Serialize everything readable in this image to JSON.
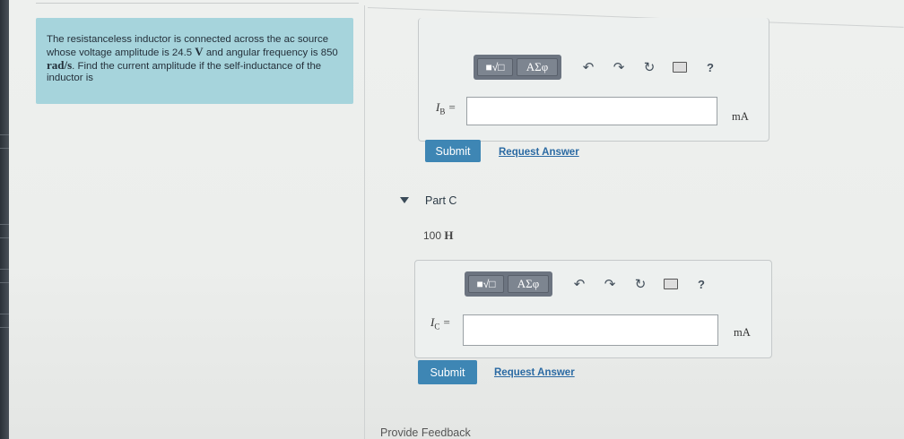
{
  "problem": {
    "text_1": "The resistanceless inductor is connected across the ac source whose voltage amplitude is 24.5 ",
    "voltage_unit": "V",
    "text_2": " and angular frequency is 850 ",
    "freq_unit": "rad/s",
    "text_3": ". Find the current amplitude if the self-inductance of the inductor is"
  },
  "part_b": {
    "var_main": "I",
    "var_sub": "B",
    "equals": " =",
    "input_value": "",
    "unit": "mA",
    "submit_label": "Submit",
    "request_label": "Request Answer"
  },
  "toolbar": {
    "matrix_label": "■√□",
    "greek_label": "ΑΣφ",
    "icons": [
      "undo-icon",
      "redo-icon",
      "reset-icon",
      "keyboard-icon",
      "help-icon"
    ],
    "help_label": "?"
  },
  "part_c": {
    "title": "Part C",
    "given_value": "100 ",
    "given_unit": "H",
    "var_main": "I",
    "var_sub": "C",
    "equals": " =",
    "input_value": "",
    "unit": "mA",
    "submit_label": "Submit",
    "request_label": "Request Answer"
  },
  "footer": {
    "feedback_label": "Provide Feedback"
  },
  "colors": {
    "problem_bg": "#a6d4dc",
    "submit_bg": "#3e86b4",
    "link": "#2b6aa3",
    "toolbar": "#6c7480"
  }
}
